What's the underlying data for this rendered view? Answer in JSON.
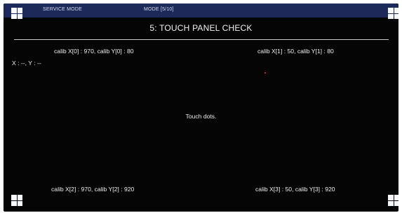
{
  "header": {
    "service_mode": "SERVICE MODE",
    "mode": "MODE [5/10]"
  },
  "page": {
    "title": "5: TOUCH PANEL CHECK",
    "coordinates": "X : --, Y : --",
    "instruction": "Touch dots."
  },
  "calibration": [
    "calib X[0] : 970, calib Y[0] : 80",
    "calib X[1] : 50, calib Y[1] : 80",
    "calib X[2] : 970, calib Y[2] : 920",
    "calib X[3] : 50, calib Y[3] : 920"
  ],
  "colors": {
    "screen_background": "#050505",
    "header_background": "#1d2a59",
    "text": "#f0f0f0",
    "touch_target": "#f7fbff",
    "red_dot": "#ff3737"
  },
  "icons": {
    "touch_target": "grid-square-icon",
    "touch_marker": "red-dot-icon"
  }
}
